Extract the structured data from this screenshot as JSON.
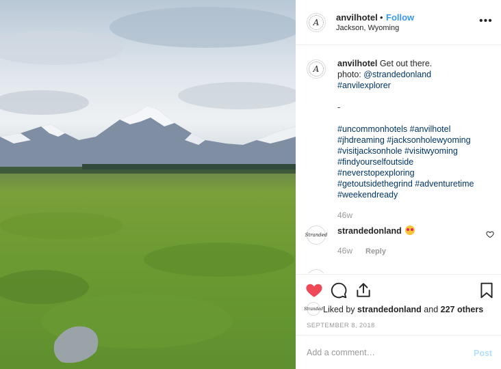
{
  "post": {
    "photo_alt": "Mountain range behind green meadow",
    "header": {
      "username": "anvilhotel",
      "separator": "•",
      "follow_label": "Follow",
      "location": "Jackson, Wyoming",
      "avatar_glyph": "A",
      "more_icon": "ellipsis-icon"
    },
    "caption": {
      "username": "anvilhotel",
      "text": "Get out there.",
      "lines": [
        "photo: @strandedonland",
        "#anvilexplorer",
        "",
        "-",
        "",
        "#uncommonhotels #anvilhotel",
        "#jhdreaming #jacksonholewyoming",
        "#visitjacksonhole #visitwyoming",
        "#findyourselfoutside",
        "#neverstopexploring",
        "#getoutsidethegrind #adventuretime",
        "#weekendready"
      ],
      "time": "46w"
    },
    "comments": [
      {
        "username": "strandedonland",
        "text": "",
        "emoji": "heart-eyes-emoji",
        "time": "46w",
        "reply_label": "Reply",
        "avatar_glyph": "Stranded"
      }
    ],
    "actions": {
      "like_icon": "heart-icon",
      "comment_icon": "comment-icon",
      "share_icon": "share-icon",
      "save_icon": "bookmark-icon",
      "liked": true
    },
    "likes": {
      "prefix": "Liked by",
      "user": "strandedonland",
      "and": "and",
      "others": "227 others"
    },
    "date": "SEPTEMBER 8, 2018",
    "comment_box": {
      "placeholder": "Add a comment…",
      "post_label": "Post"
    },
    "colors": {
      "link_blue": "#3897f0",
      "hashtag_blue": "#003569",
      "like_red": "#ed4956",
      "muted": "#999999"
    }
  }
}
